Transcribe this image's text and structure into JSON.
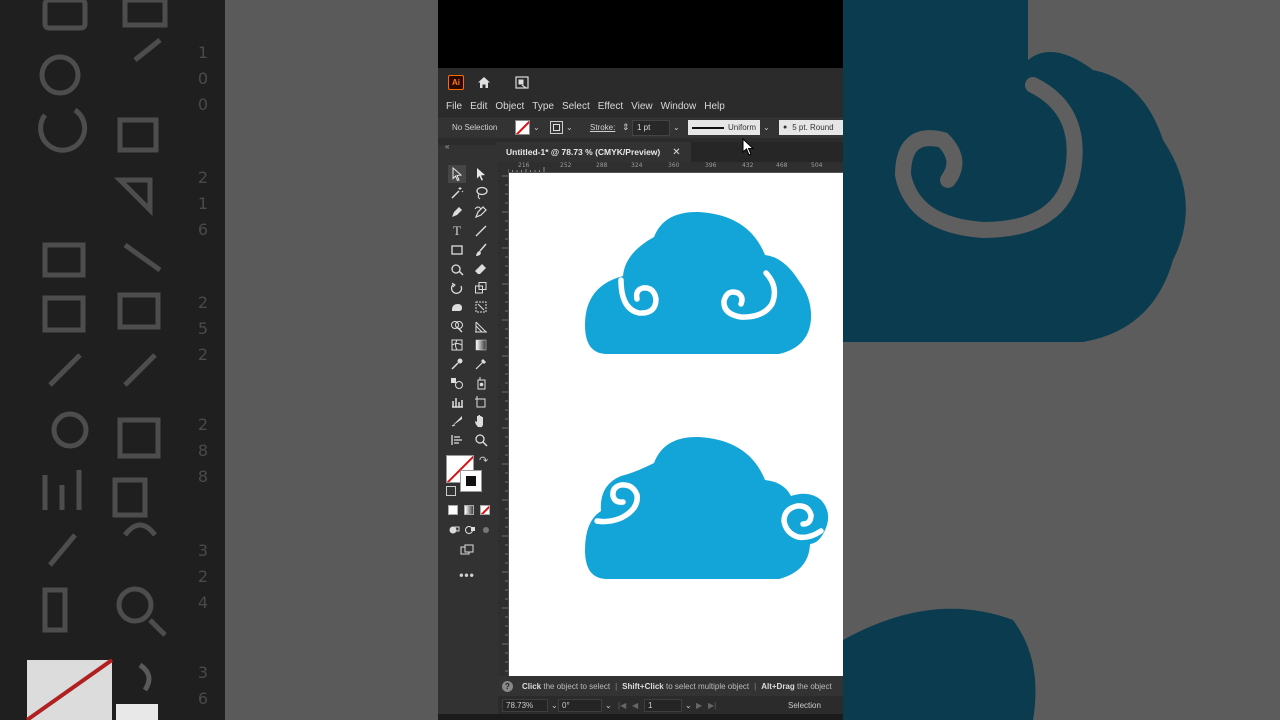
{
  "app": {
    "logo_text": "Ai",
    "menu": [
      "File",
      "Edit",
      "Object",
      "Type",
      "Select",
      "Effect",
      "View",
      "Window",
      "Help"
    ]
  },
  "control_bar": {
    "selection_label": "No Selection",
    "stroke_label": "Stroke:",
    "stroke_weight": "1 pt",
    "profile_label": "Uniform",
    "brush_label": "5 pt. Round"
  },
  "document": {
    "tab_title": "Untitled-1* @ 78.73 % (CMYK/Preview)",
    "ruler_ticks": [
      "216",
      "252",
      "288",
      "324",
      "360",
      "396",
      "432",
      "468",
      "504"
    ]
  },
  "artwork": {
    "cloud_color": "#14a5d8",
    "swirl_color": "#ffffff"
  },
  "status": {
    "hint_1": "Click",
    "hint_2": "the object to select",
    "hint_3": "Shift+Click",
    "hint_4": "to select multiple object",
    "hint_5": "Alt+Drag",
    "hint_6": "the object"
  },
  "bottom_bar": {
    "zoom": "78.73%",
    "rotation": "0°",
    "artboard": "1",
    "tool_name": "Selection"
  },
  "background_ruler_digits": [
    "1",
    "0",
    "0",
    "2",
    "1",
    "6",
    "2",
    "5",
    "2",
    "2",
    "8",
    "8",
    "3",
    "2",
    "4",
    "3",
    "6"
  ]
}
